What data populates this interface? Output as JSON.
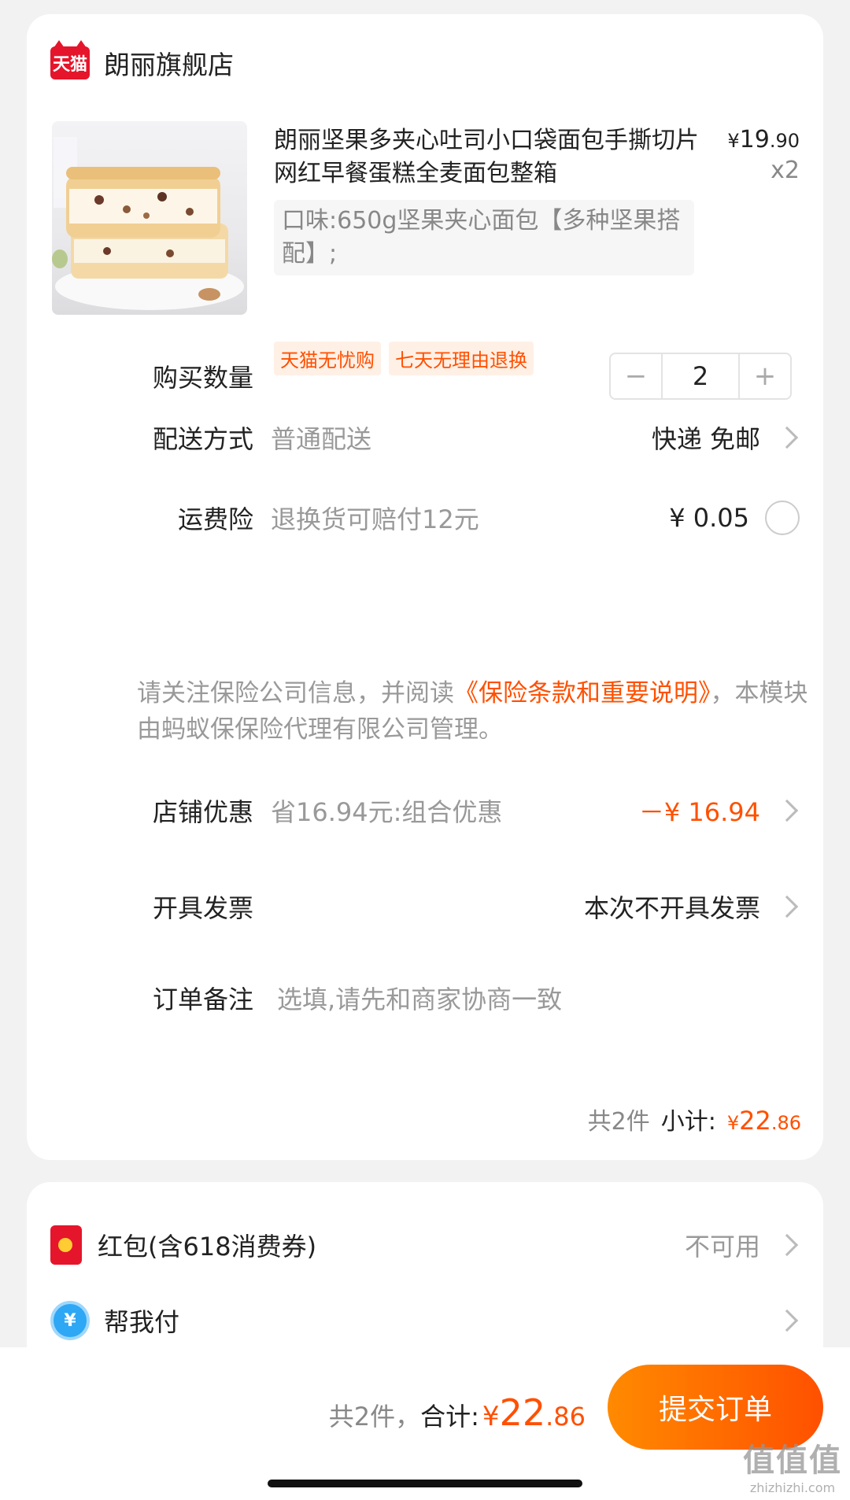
{
  "store": {
    "logo_text": "天猫",
    "name": "朗丽旗舰店"
  },
  "product": {
    "title": "朗丽坚果多夹心吐司小口袋面包手撕切片网红早餐蛋糕全麦面包整箱",
    "price_yen": "¥",
    "price_int": "19",
    "price_dec": ".90",
    "quantity_label": "x2",
    "sku": "口味:650g坚果夹心面包【多种坚果搭配】;",
    "tags": [
      "天猫无忧购",
      "七天无理由退换"
    ]
  },
  "quantity": {
    "label": "购买数量",
    "minus": "−",
    "value": "2",
    "plus": "+"
  },
  "delivery": {
    "label": "配送方式",
    "sub": "普通配送",
    "value": "快递 免邮"
  },
  "shipping_insurance": {
    "label": "运费险",
    "sub": "退换货可赔付12元",
    "value": "¥ 0.05"
  },
  "notice": {
    "text_before": "请关注保险公司信息，并阅读",
    "link": "《保险条款和重要说明》",
    "text_after": "，本模块由蚂蚁保保险代理有限公司管理。"
  },
  "store_discount": {
    "label": "店铺优惠",
    "sub": "省16.94元:组合优惠",
    "value": "－¥ 16.94"
  },
  "invoice": {
    "label": "开具发票",
    "value": "本次不开具发票"
  },
  "remark": {
    "label": "订单备注",
    "placeholder": "选填,请先和商家协商一致"
  },
  "subtotal": {
    "count": "共2件",
    "label": "小计:",
    "yen": "¥",
    "int": "22",
    "dec": ".86"
  },
  "red_packet": {
    "label": "红包(含618消费券)",
    "value": "不可用"
  },
  "help_pay": {
    "icon_text": "¥",
    "label": "帮我付"
  },
  "footer": {
    "count": "共2件，",
    "label": "合计:",
    "yen": "¥",
    "int": "22",
    "dec": ".86",
    "submit": "提交订单"
  },
  "watermark": {
    "big": "值值值",
    "small": "zhizhizhi.com"
  },
  "colors": {
    "accent": "#ff5000",
    "tmall_red": "#e5152b",
    "background": "#f2f2f2"
  }
}
